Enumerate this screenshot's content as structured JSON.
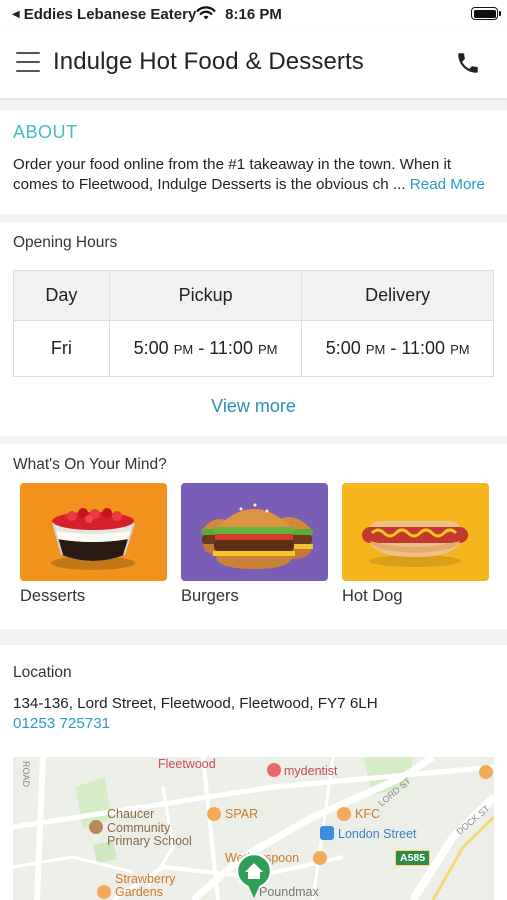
{
  "status_bar": {
    "back_app": "Eddies Lebanese Eatery",
    "time": "8:16 PM"
  },
  "header": {
    "title": "Indulge Hot Food & Desserts"
  },
  "about": {
    "title": "ABOUT",
    "text": "Order your food online from the #1 takeaway in the town. When it comes to Fleetwood, Indulge Desserts is the obvious ch ...",
    "read_more": "Read More"
  },
  "opening_hours": {
    "label": "Opening Hours",
    "headers": [
      "Day",
      "Pickup",
      "Delivery"
    ],
    "rows": [
      {
        "day": "Fri",
        "pickup_from": "5:00",
        "pickup_from_ampm": "PM",
        "pickup_to": "11:00",
        "pickup_to_ampm": "PM",
        "delivery_from": "5:00",
        "delivery_from_ampm": "PM",
        "delivery_to": "11:00",
        "delivery_to_ampm": "PM"
      }
    ],
    "separator": "-",
    "view_more": "View more"
  },
  "mind": {
    "label": "What's On Your Mind?",
    "categories": [
      {
        "label": "Desserts",
        "color": "#f0921c"
      },
      {
        "label": "Burgers",
        "color": "#7a5db5"
      },
      {
        "label": "Hot Dog",
        "color": "#f7b51d"
      }
    ]
  },
  "location": {
    "label": "Location",
    "address": "134-136, Lord Street, Fleetwood, Fleetwood, FY7 6LH",
    "phone": "01253 725731",
    "map_labels": {
      "fleetwood": "Fleetwood",
      "mydentist": "mydentist",
      "road": "ROAD",
      "lord_st": "LORD ST",
      "dock_st": "DOCK ST",
      "chaucer": "Chaucer",
      "community": "Community",
      "primary": "Primary School",
      "spar": "SPAR",
      "kfc": "KFC",
      "london_street": "London Street",
      "wetherspoon": "Wetherspoon",
      "a585": "A585",
      "strawberry": "Strawberry",
      "gardens": "Gardens",
      "poundmax": "Poundmax"
    }
  },
  "colors": {
    "accent": "#3dbdc5",
    "link": "#2a9ac8",
    "map_pin": "#2f9e59"
  },
  "icons": [
    "chevron-back-icon",
    "wifi-icon",
    "battery-icon",
    "menu-icon",
    "phone-icon",
    "home-pin-icon"
  ]
}
